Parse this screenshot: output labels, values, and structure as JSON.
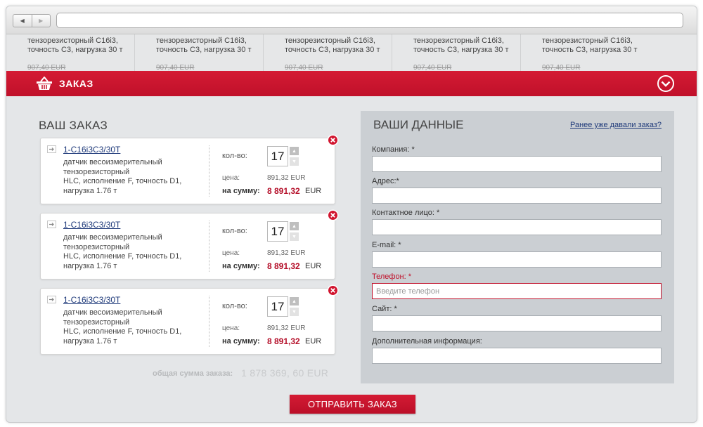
{
  "browser": {
    "back_glyph": "◀",
    "forward_glyph": "▶",
    "address_value": ""
  },
  "products": [
    {
      "name_line1": "тензорезисторный С16і3,",
      "name_line2": "точность С3, нагрузка 30 т",
      "old_price": "907,40 EUR"
    },
    {
      "name_line1": "тензорезисторный С16і3,",
      "name_line2": "точность С3, нагрузка 30 т",
      "old_price": "907,40 EUR"
    },
    {
      "name_line1": "тензорезисторный С16і3,",
      "name_line2": "точность С3, нагрузка 30 т",
      "old_price": "907,40 EUR"
    },
    {
      "name_line1": "тензорезисторный С16і3,",
      "name_line2": "точность С3, нагрузка 30 т",
      "old_price": "907,40 EUR"
    },
    {
      "name_line1": "тензорезисторный С16і3,",
      "name_line2": "точность С3, нагрузка 30 т",
      "old_price": "907,40 EUR"
    }
  ],
  "order_bar": {
    "title": "ЗАКАЗ",
    "icon": "basket-icon",
    "collapse_icon": "chevron-down-circle-icon"
  },
  "order": {
    "title": "ВАШ ЗАКАЗ",
    "items": [
      {
        "sku": "1-C16i3C3/30T",
        "desc_line1": "датчик весоизмерительный",
        "desc_line2": "тензорезисторный",
        "desc_line3": "HLC, исполнение F, точность D1,",
        "desc_line4": "нагрузка 1.76 т",
        "qty_label": "кол-во:",
        "qty": "17",
        "price_label": "цена:",
        "price": "891,32 EUR",
        "sum_label": "на сумму:",
        "sum": "8 891,32",
        "sum_currency": "EUR"
      },
      {
        "sku": "1-C16i3C3/30T",
        "desc_line1": "датчик весоизмерительный",
        "desc_line2": "тензорезисторный",
        "desc_line3": "HLC, исполнение F, точность D1,",
        "desc_line4": "нагрузка 1.76 т",
        "qty_label": "кол-во:",
        "qty": "17",
        "price_label": "цена:",
        "price": "891,32 EUR",
        "sum_label": "на сумму:",
        "sum": "8 891,32",
        "sum_currency": "EUR"
      },
      {
        "sku": "1-C16i3C3/30T",
        "desc_line1": "датчик весоизмерительный",
        "desc_line2": "тензорезисторный",
        "desc_line3": "HLC, исполнение F, точность D1,",
        "desc_line4": "нагрузка 1.76 т",
        "qty_label": "кол-во:",
        "qty": "17",
        "price_label": "цена:",
        "price": "891,32 EUR",
        "sum_label": "на сумму:",
        "sum": "8 891,32",
        "sum_currency": "EUR"
      }
    ],
    "total_label": "общая сумма заказа:",
    "total_value": "1 878 369, 60 EUR"
  },
  "form": {
    "title": "ВАШИ ДАННЫЕ",
    "returning_link": "Ранее уже давали заказ?",
    "fields": [
      {
        "label": "Компания: *",
        "value": "",
        "placeholder": ""
      },
      {
        "label": "Адрес:*",
        "value": "",
        "placeholder": ""
      },
      {
        "label": "Контактное лицо: *",
        "value": "",
        "placeholder": ""
      },
      {
        "label": "E-mail: *",
        "value": "",
        "placeholder": ""
      },
      {
        "label": "Телефон: *",
        "value": "",
        "placeholder": "Введите телефон"
      },
      {
        "label": "Сайт: *",
        "value": "",
        "placeholder": ""
      },
      {
        "label": "Дополнительная информация:",
        "value": "",
        "placeholder": ""
      }
    ],
    "error_color": "#c0102a"
  },
  "submit_label": "ОТПРАВИТЬ ЗАКАЗ",
  "colors": {
    "brand_red": "#c8152f",
    "panel_gray": "#cbcfd3",
    "link_blue": "#1f3a7a"
  }
}
